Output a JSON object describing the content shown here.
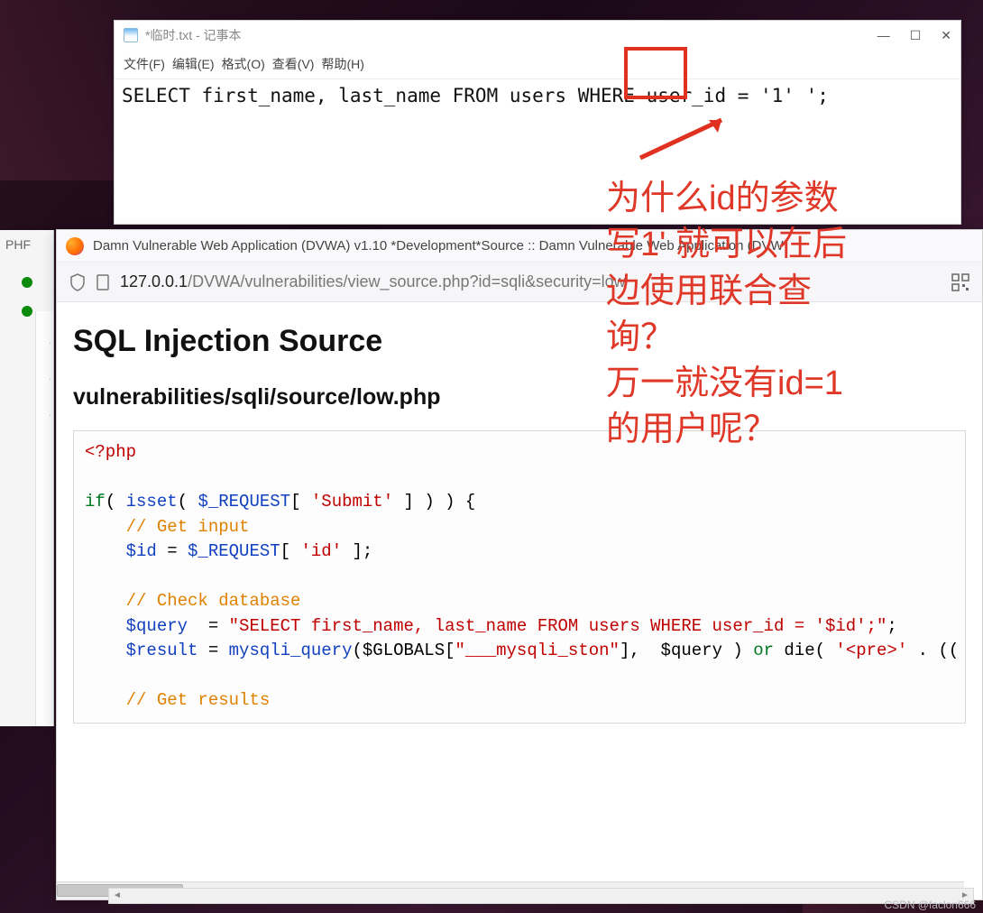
{
  "notepad": {
    "title": "*临时.txt - 记事本",
    "menu": [
      "文件(F)",
      "编辑(E)",
      "格式(O)",
      "查看(V)",
      "帮助(H)"
    ],
    "content": "SELECT first_name, last_name FROM users WHERE user_id = '1'       ';"
  },
  "annotation": {
    "line1": "为什么id的参数",
    "line2": "写1' 就可以在后",
    "line3": "边使用联合查",
    "line4": "询？",
    "line5": "万一就没有id=1",
    "line6": "的用户呢？"
  },
  "browser": {
    "title": "Damn Vulnerable Web Application (DVWA) v1.10 *Development*Source :: Damn Vulnerable Web Application (DVW",
    "url_domain": "127.0.0.1",
    "url_path": "/DVWA/vulnerabilities/view_source.php?id=sqli&security=low",
    "page_title": "SQL Injection Source",
    "page_subtitle": "vulnerabilities/sqli/source/low.php",
    "code": {
      "open_tag": "<?php",
      "if_line_pre": "if( isset( $_REQUEST[ ",
      "if_line_str": "'Submit'",
      "if_line_post": " ] ) ) {",
      "cm_input": "// Get input",
      "id_assign_pre": "$id = $_REQUEST[ ",
      "id_assign_str": "'id'",
      "id_assign_post": " ];",
      "cm_check": "// Check database",
      "q_var": "$query",
      "q_eq": "  = ",
      "q_str": "\"SELECT first_name, last_name FROM users WHERE user_id = '$id';\"",
      "q_end": ";",
      "r_var": "$result",
      "r_eq": " = ",
      "r_fn": "mysqli_query",
      "r_arg1_pre": "($GLOBALS[",
      "r_arg1_str": "\"___mysqli_ston\"",
      "r_arg1_post": "],  $query ) ",
      "r_or": "or",
      "r_die": " die( ",
      "r_pre_str": "'<pre>'",
      "r_tail": " . ((",
      "cm_results": "// Get results"
    }
  },
  "side": {
    "label": "PHF"
  },
  "watermark": "CSDN @faclon666"
}
